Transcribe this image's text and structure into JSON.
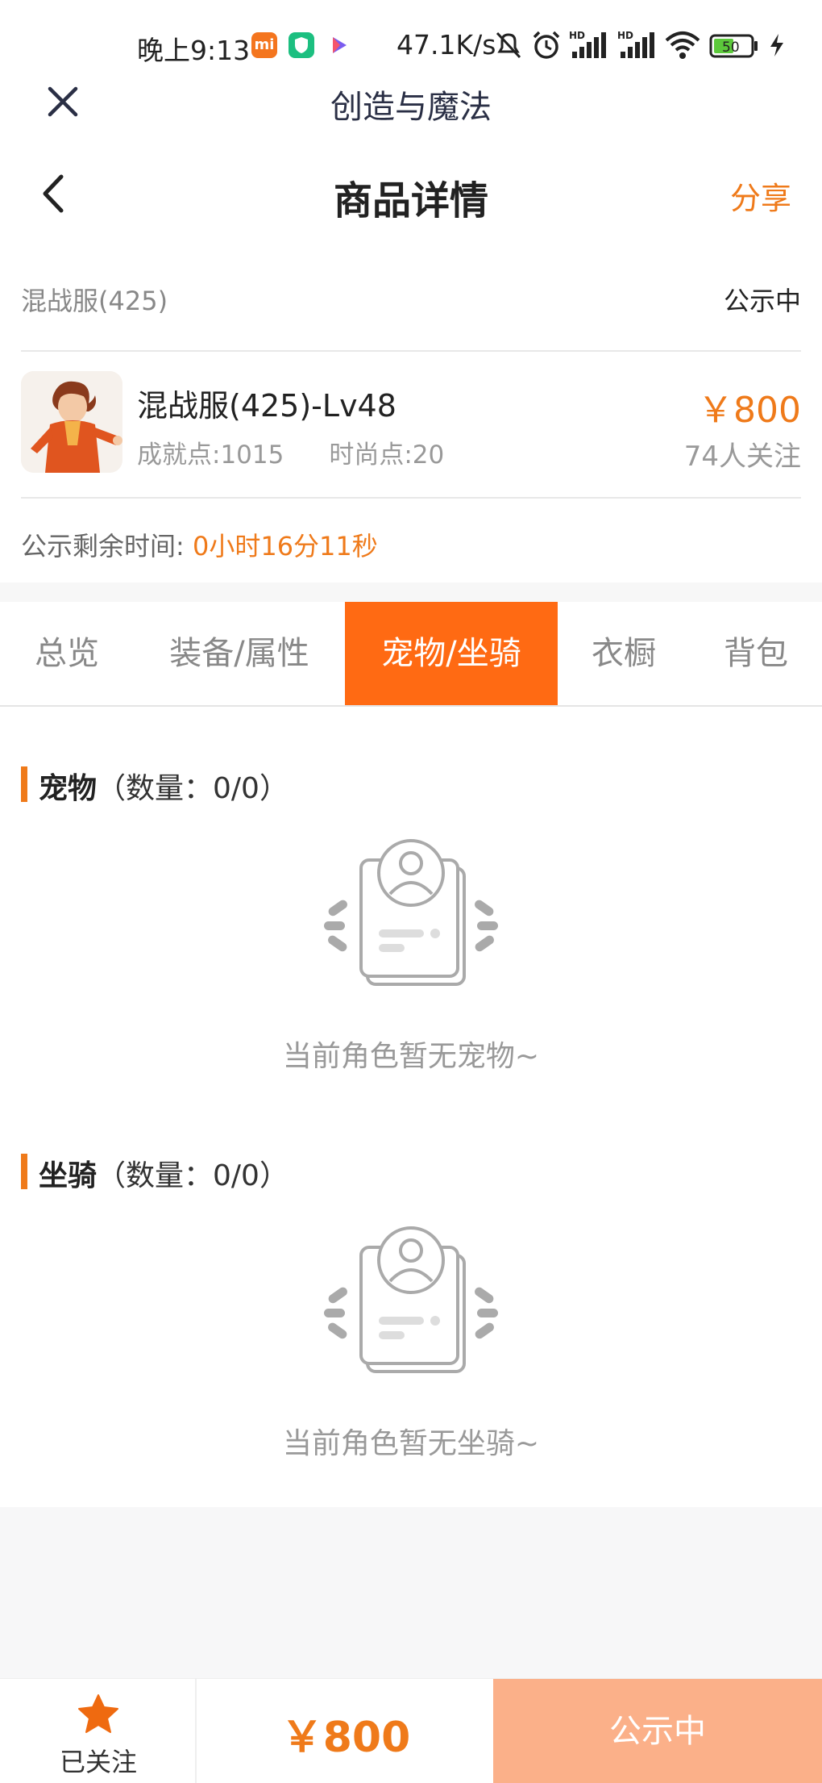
{
  "status_bar": {
    "time": "晚上9:13",
    "net_speed": "47.1K/s",
    "battery": "50"
  },
  "webview": {
    "title": "创造与魔法"
  },
  "header": {
    "title": "商品详情",
    "share_label": "分享"
  },
  "product": {
    "server": "混战服(425)",
    "status": "公示中",
    "name": "混战服(425)-Lv48",
    "achievement": "成就点:1015",
    "fashion": "时尚点:20",
    "price": "￥800",
    "followers": "74人关注",
    "timer_label": "公示剩余时间:",
    "timer_value": "0小时16分11秒"
  },
  "tabs": [
    {
      "label": "总览",
      "active": false
    },
    {
      "label": "装备/属性",
      "active": false
    },
    {
      "label": "宠物/坐骑",
      "active": true
    },
    {
      "label": "衣橱",
      "active": false
    },
    {
      "label": "背包",
      "active": false
    }
  ],
  "sections": {
    "pets": {
      "title": "宠物",
      "count": "（数量：0/0）",
      "empty_text": "当前角色暂无宠物~"
    },
    "mounts": {
      "title": "坐骑",
      "count": "（数量：0/0）",
      "empty_text": "当前角色暂无坐骑~"
    }
  },
  "bottom_bar": {
    "follow_label": "已关注",
    "price": "￥800",
    "action_label": "公示中"
  },
  "colors": {
    "accent": "#ef7a1a",
    "active_tab": "#ff6a13",
    "disabled_button": "#fbb089"
  }
}
